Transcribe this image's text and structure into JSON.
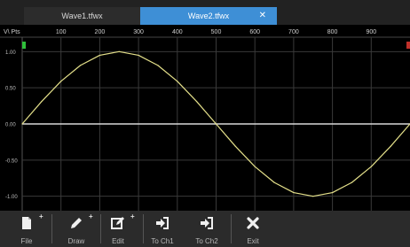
{
  "tabs": [
    {
      "label": "Wave1.tfwx"
    },
    {
      "label": "Wave2.tfwx",
      "active": true
    }
  ],
  "plot": {
    "corner_label": "V\\ Pts",
    "x_ticks": [
      "100",
      "200",
      "300",
      "400",
      "500",
      "600",
      "700",
      "800",
      "900"
    ],
    "y_ticks": [
      "1.00",
      "0.50",
      "0.00",
      "-0.50",
      "-1.00"
    ]
  },
  "chart_data": {
    "type": "line",
    "x_range": [
      0,
      1000
    ],
    "ylim": [
      -1.2,
      1.2
    ],
    "grid": true,
    "series": [
      {
        "x": [
          0,
          50,
          100,
          150,
          200,
          250,
          300,
          350,
          400,
          450,
          500,
          550,
          600,
          650,
          700,
          750,
          800,
          850,
          900,
          950,
          1000
        ],
        "values": [
          0,
          0.31,
          0.59,
          0.81,
          0.95,
          1.0,
          0.95,
          0.81,
          0.59,
          0.31,
          0,
          -0.31,
          -0.59,
          -0.81,
          -0.95,
          -1.0,
          -0.95,
          -0.81,
          -0.59,
          -0.31,
          0
        ],
        "color": "#e4e08a"
      }
    ]
  },
  "toolbar": {
    "file": "File",
    "draw": "Draw",
    "edit": "Edit",
    "to_ch1": "To Ch1",
    "to_ch2": "To Ch2",
    "exit": "Exit"
  },
  "colors": {
    "accent_tab": "#3e8fd6",
    "marker_green": "#2fbf3a",
    "marker_red": "#c0302a"
  }
}
